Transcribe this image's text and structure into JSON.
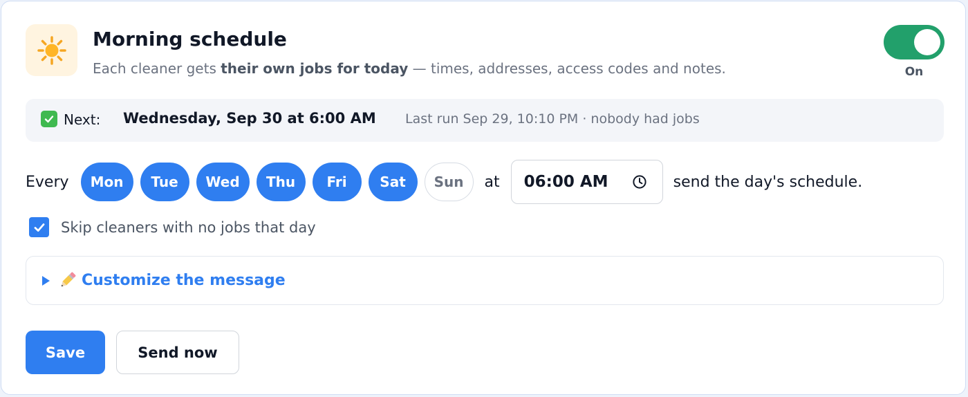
{
  "header": {
    "icon": "sun-icon",
    "title": "Morning schedule",
    "subtitle_prefix": "Each cleaner gets ",
    "subtitle_bold": "their own jobs for today",
    "subtitle_suffix": " — times, addresses, access codes and notes."
  },
  "toggle": {
    "state": "On",
    "on": true,
    "color": "#22a06b"
  },
  "next": {
    "icon": "check-mark-icon",
    "label": "Next:",
    "when": "Wednesday, Sep 30 at 6:00 AM",
    "last_run": "Last run Sep 29, 10:10 PM · nobody had jobs"
  },
  "schedule": {
    "every_label": "Every",
    "days": [
      {
        "label": "Mon",
        "selected": true
      },
      {
        "label": "Tue",
        "selected": true
      },
      {
        "label": "Wed",
        "selected": true
      },
      {
        "label": "Thu",
        "selected": true
      },
      {
        "label": "Fri",
        "selected": true
      },
      {
        "label": "Sat",
        "selected": true
      },
      {
        "label": "Sun",
        "selected": false
      }
    ],
    "at_label": "at",
    "time_value": "06:00 AM",
    "time_icon": "clock-icon",
    "suffix": "send the day's schedule."
  },
  "skip": {
    "checked": true,
    "label": "Skip cleaners with no jobs that day"
  },
  "customize": {
    "icon": "pencil-icon",
    "label": "Customize the message",
    "expanded": false
  },
  "actions": {
    "save_label": "Save",
    "send_now_label": "Send now"
  },
  "colors": {
    "accent": "#2f7ef0",
    "success": "#22a06b",
    "muted": "#6b7280"
  }
}
